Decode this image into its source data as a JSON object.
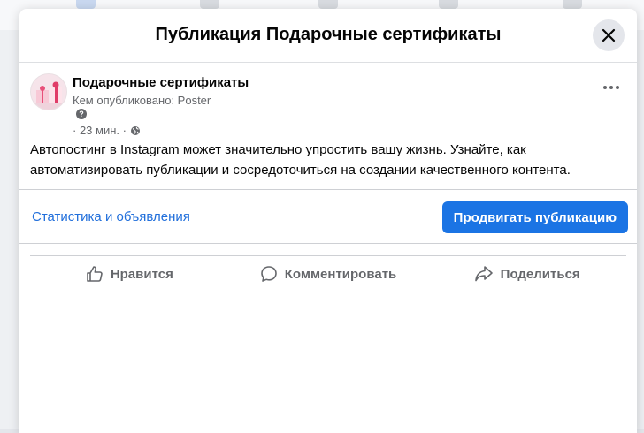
{
  "modal": {
    "title": "Публикация Подарочные сертификаты"
  },
  "post": {
    "page_name": "Подарочные сертификаты",
    "posted_by": "Кем опубликовано: Poster",
    "time": "· 23 мин. ·",
    "text": "Автопостинг в Instagram может значительно упростить вашу жизнь. Узнайте, как автоматизировать публикации и сосредоточиться на создании качественного контента."
  },
  "footer": {
    "stats_link": "Статистика и объявления",
    "promote_button": "Продвигать публикацию"
  },
  "actions": [
    {
      "label": "Нравится",
      "icon": "like-icon"
    },
    {
      "label": "Комментировать",
      "icon": "comment-icon"
    },
    {
      "label": "Поделиться",
      "icon": "share-icon"
    }
  ],
  "colors": {
    "accent": "#1b74e4",
    "link": "#216fdb",
    "secondary_text": "#65676b"
  }
}
